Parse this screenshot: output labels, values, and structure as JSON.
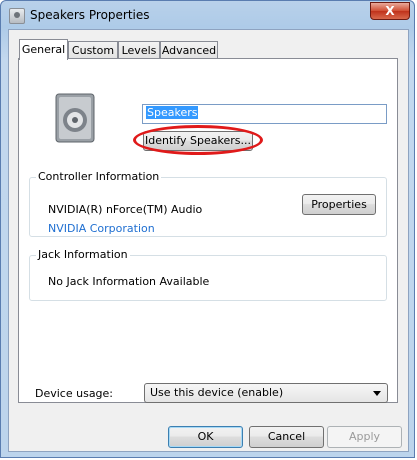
{
  "window": {
    "title": "Speakers Properties",
    "close_glyph": "X"
  },
  "tabs": [
    {
      "label": "General",
      "active": true
    },
    {
      "label": "Custom",
      "active": false
    },
    {
      "label": "Levels",
      "active": false
    },
    {
      "label": "Advanced",
      "active": false
    }
  ],
  "general": {
    "device_icon": "speaker-icon",
    "device_name": "Speakers",
    "identify_label": "Identify Speakers...",
    "controller": {
      "section_label": "Controller Information",
      "name": "NVIDIA(R) nForce(TM) Audio",
      "vendor": "NVIDIA Corporation",
      "properties_label": "Properties"
    },
    "jack": {
      "section_label": "Jack Information",
      "text": "No Jack Information Available"
    },
    "usage": {
      "label": "Device usage:",
      "selected": "Use this device (enable)"
    }
  },
  "buttons": {
    "ok": "OK",
    "cancel": "Cancel",
    "apply": "Apply"
  },
  "colors": {
    "highlight_oval": "#e01a1a",
    "link": "#1f6fd1",
    "selection": "#3399ff"
  }
}
